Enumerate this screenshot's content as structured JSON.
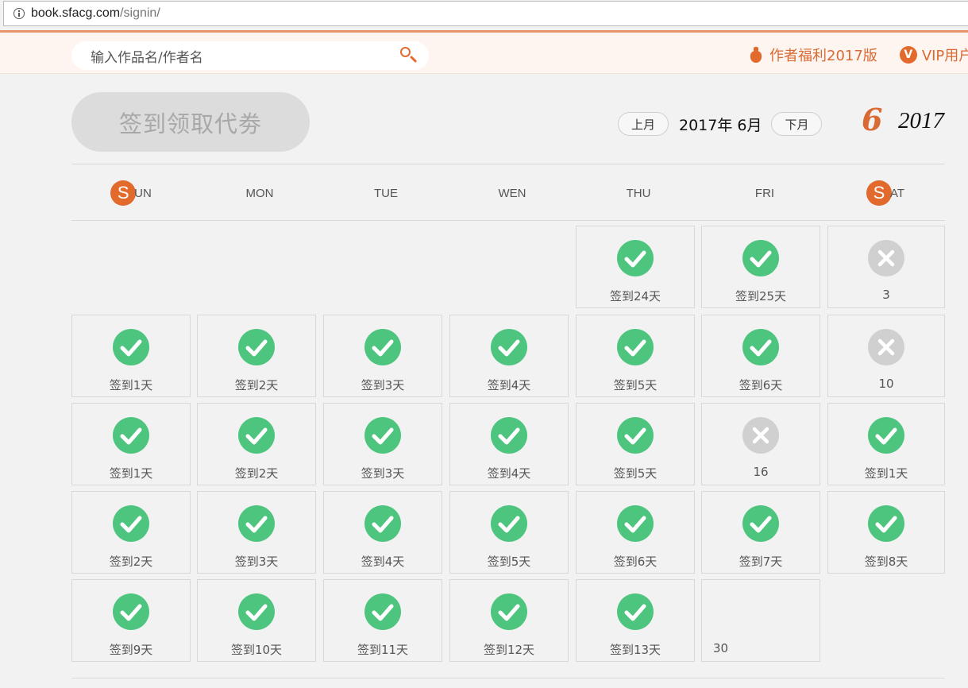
{
  "browser": {
    "url_host": "book.sfacg.com",
    "url_path": "/signin/"
  },
  "header": {
    "search_placeholder": "输入作品名/作者名",
    "links": [
      {
        "label": "作者福利2017版",
        "icon": "money-bag-icon"
      },
      {
        "label": "VIP用户",
        "icon": "vip-badge-icon",
        "badge": "V"
      }
    ]
  },
  "signin": {
    "button_label": "签到领取代劵"
  },
  "calendar": {
    "prev_label": "上月",
    "next_label": "下月",
    "current_label": "2017年  6月",
    "big_month": "6",
    "big_year": "2017",
    "weekend_badge": "S",
    "weekdays": [
      "UN",
      "MON",
      "TUE",
      "WEN",
      "THU",
      "FRI",
      "AT"
    ],
    "days": [
      {
        "col": 4,
        "row": 0,
        "status": "ok",
        "label": "签到24天"
      },
      {
        "col": 5,
        "row": 0,
        "status": "ok",
        "label": "签到25天"
      },
      {
        "col": 6,
        "row": 0,
        "status": "no",
        "label": "3"
      },
      {
        "col": 0,
        "row": 1,
        "status": "ok",
        "label": "签到1天"
      },
      {
        "col": 1,
        "row": 1,
        "status": "ok",
        "label": "签到2天"
      },
      {
        "col": 2,
        "row": 1,
        "status": "ok",
        "label": "签到3天"
      },
      {
        "col": 3,
        "row": 1,
        "status": "ok",
        "label": "签到4天"
      },
      {
        "col": 4,
        "row": 1,
        "status": "ok",
        "label": "签到5天"
      },
      {
        "col": 5,
        "row": 1,
        "status": "ok",
        "label": "签到6天"
      },
      {
        "col": 6,
        "row": 1,
        "status": "no",
        "label": "10"
      },
      {
        "col": 0,
        "row": 2,
        "status": "ok",
        "label": "签到1天"
      },
      {
        "col": 1,
        "row": 2,
        "status": "ok",
        "label": "签到2天"
      },
      {
        "col": 2,
        "row": 2,
        "status": "ok",
        "label": "签到3天"
      },
      {
        "col": 3,
        "row": 2,
        "status": "ok",
        "label": "签到4天"
      },
      {
        "col": 4,
        "row": 2,
        "status": "ok",
        "label": "签到5天"
      },
      {
        "col": 5,
        "row": 2,
        "status": "no",
        "label": "16"
      },
      {
        "col": 6,
        "row": 2,
        "status": "ok",
        "label": "签到1天"
      },
      {
        "col": 0,
        "row": 3,
        "status": "ok",
        "label": "签到2天"
      },
      {
        "col": 1,
        "row": 3,
        "status": "ok",
        "label": "签到3天"
      },
      {
        "col": 2,
        "row": 3,
        "status": "ok",
        "label": "签到4天"
      },
      {
        "col": 3,
        "row": 3,
        "status": "ok",
        "label": "签到5天"
      },
      {
        "col": 4,
        "row": 3,
        "status": "ok",
        "label": "签到6天"
      },
      {
        "col": 5,
        "row": 3,
        "status": "ok",
        "label": "签到7天"
      },
      {
        "col": 6,
        "row": 3,
        "status": "ok",
        "label": "签到8天"
      },
      {
        "col": 0,
        "row": 4,
        "status": "ok",
        "label": "签到9天"
      },
      {
        "col": 1,
        "row": 4,
        "status": "ok",
        "label": "签到10天"
      },
      {
        "col": 2,
        "row": 4,
        "status": "ok",
        "label": "签到11天"
      },
      {
        "col": 3,
        "row": 4,
        "status": "ok",
        "label": "签到12天"
      },
      {
        "col": 4,
        "row": 4,
        "status": "ok",
        "label": "签到13天"
      },
      {
        "col": 5,
        "row": 4,
        "status": "pending",
        "label": "30"
      }
    ]
  },
  "colors": {
    "accent": "#e26a2c",
    "checked": "#4ec57f",
    "missed": "#d0d0d0"
  }
}
